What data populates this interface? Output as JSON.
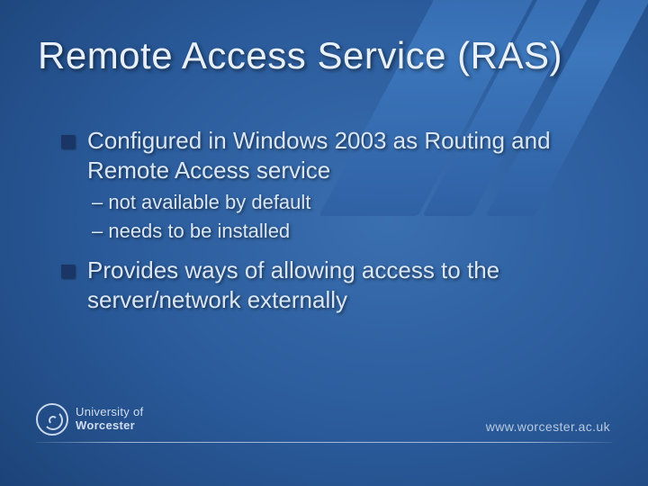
{
  "title": "Remote Access Service (RAS)",
  "bullets": [
    {
      "text": "Configured in Windows 2003 as Routing and Remote Access service",
      "subs": [
        "– not available by default",
        "– needs to be installed"
      ]
    },
    {
      "text": "Provides ways of allowing access to the server/network externally",
      "subs": []
    }
  ],
  "footer": {
    "logo_line1": "University of",
    "logo_line2": "Worcester",
    "url": "www.worcester.ac.uk"
  }
}
